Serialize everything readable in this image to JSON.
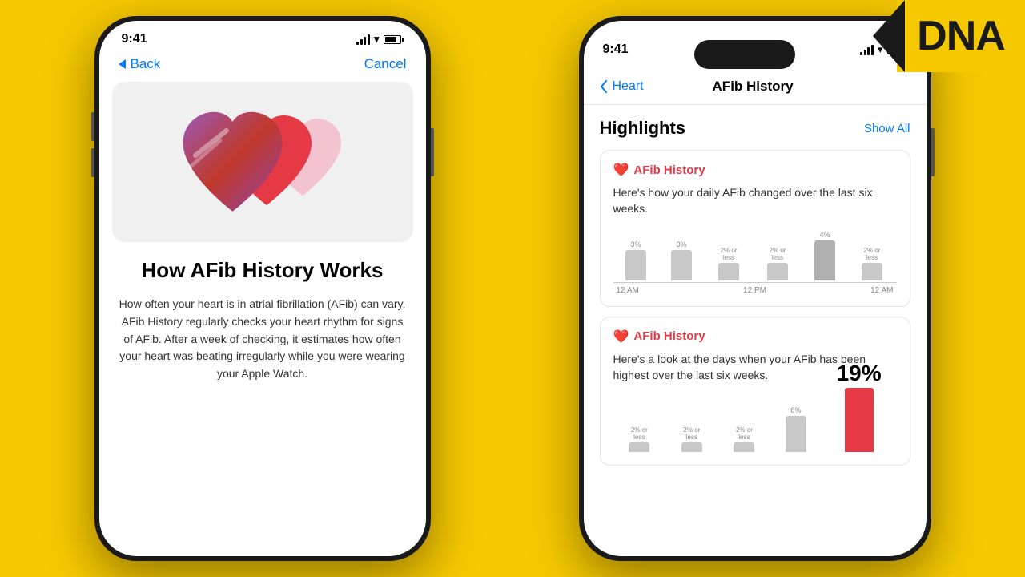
{
  "page": {
    "background_color": "#f5c800"
  },
  "dna_logo": {
    "text": "DNA",
    "color": "#1a1a1a"
  },
  "phone_left": {
    "status_bar": {
      "time": "9:41"
    },
    "nav": {
      "back_label": "Back",
      "cancel_label": "Cancel"
    },
    "heart_section": {
      "alt": "Heart icons illustration"
    },
    "title": "How AFib History Works",
    "description": "How often your heart is in atrial fibrillation (AFib) can vary. AFib History regularly checks your heart rhythm for signs of AFib. After a week of checking, it estimates how often your heart was beating irregularly while you were wearing your Apple Watch."
  },
  "phone_right": {
    "status_bar": {
      "time": "9:41"
    },
    "nav": {
      "back_label": "Heart",
      "title": "AFib History"
    },
    "highlights_section": {
      "title": "Highlights",
      "show_all": "Show All"
    },
    "card1": {
      "icon": "❤️",
      "title": "AFib History",
      "description": "Here's how your daily AFib changed over the last six weeks.",
      "bars": [
        {
          "label": "3%",
          "height": 38
        },
        {
          "label": "3%",
          "height": 38
        },
        {
          "label": "2% or less",
          "height": 22
        },
        {
          "label": "2% or less",
          "height": 22
        },
        {
          "label": "4%",
          "height": 50
        },
        {
          "label": "2% or less",
          "height": 22
        }
      ],
      "x_labels": [
        "12 AM",
        "12 PM",
        "12 AM"
      ]
    },
    "card2": {
      "icon": "❤️",
      "title": "AFib History",
      "description": "Here's a look at the days when your AFib has been highest over the last six weeks.",
      "percentage": "19%",
      "bottom_bars": [
        {
          "label": "2% or less",
          "height": 12,
          "color": "#c8c8c8"
        },
        {
          "label": "2% or less",
          "height": 12,
          "color": "#c8c8c8"
        },
        {
          "label": "2% or less",
          "height": 12,
          "color": "#c8c8c8"
        },
        {
          "label": "8%",
          "height": 45,
          "color": "#c8c8c8"
        },
        {
          "label": "19%",
          "height": 80,
          "color": "#e63946"
        }
      ]
    }
  }
}
